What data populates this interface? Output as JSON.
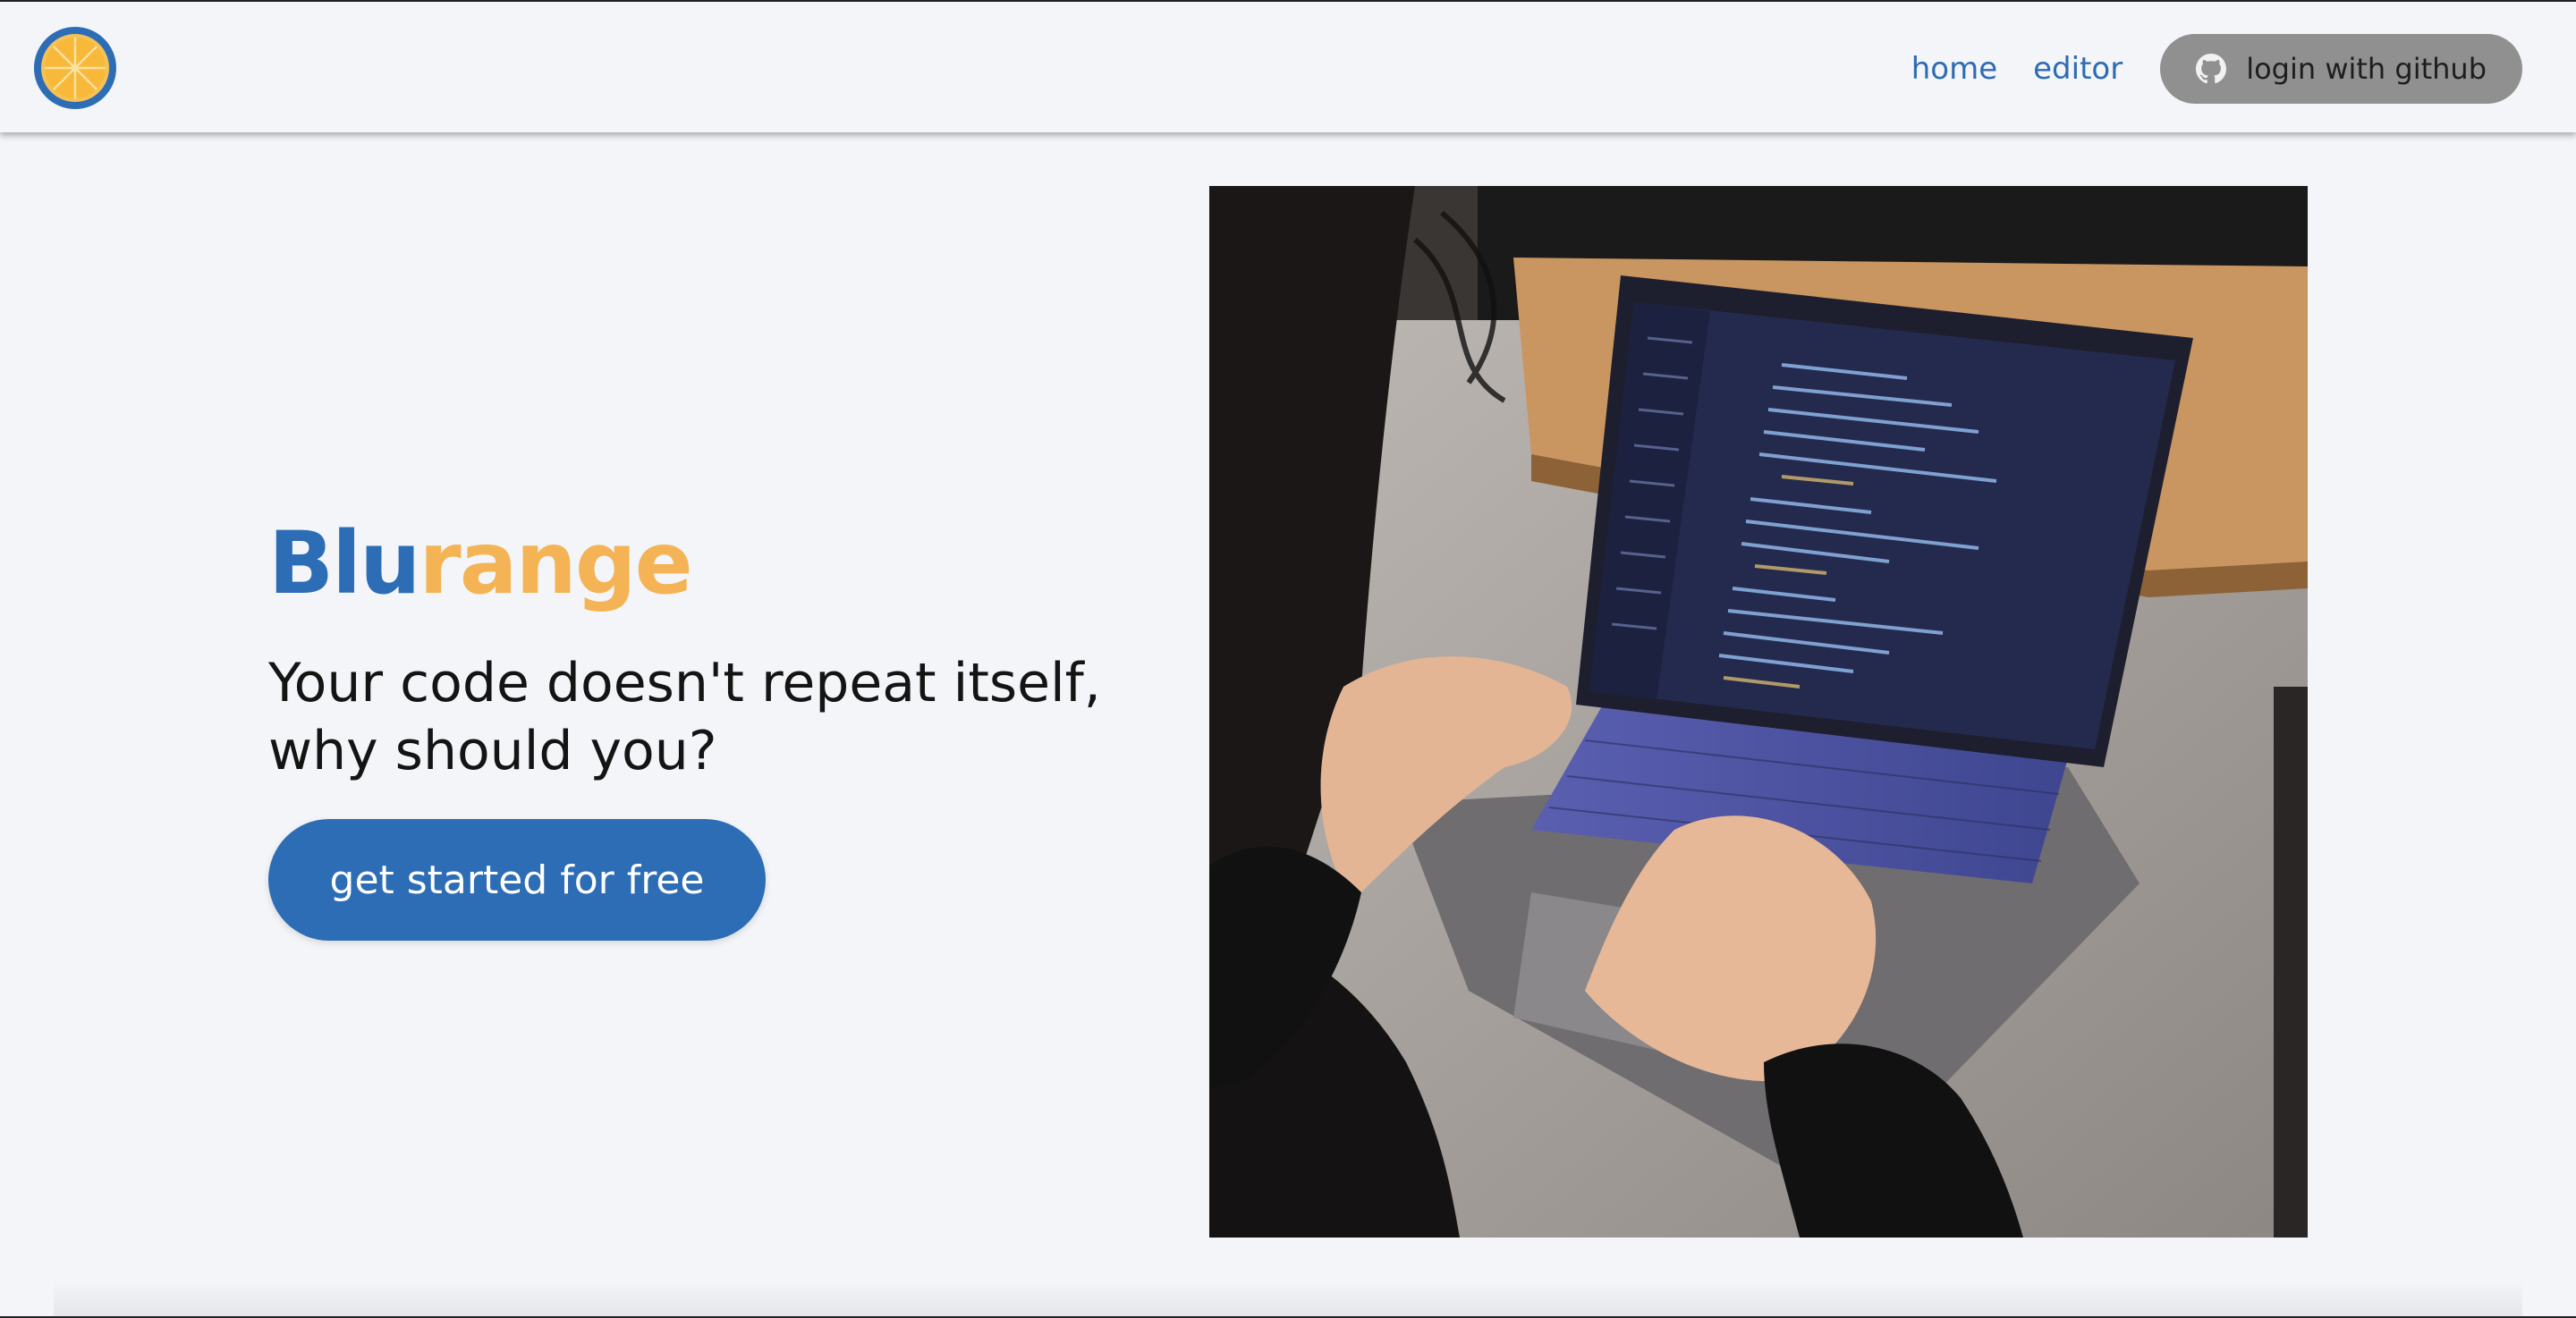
{
  "header": {
    "logo_icon": "orange-slice-logo-icon",
    "nav": {
      "home_label": "home",
      "editor_label": "editor"
    },
    "login": {
      "icon": "github-icon",
      "label": "login with github"
    }
  },
  "hero": {
    "brand_part1": "Blu",
    "brand_part2": "range",
    "tagline_line1": "Your code doesn't repeat itself,",
    "tagline_line2": "why should you?",
    "cta_label": "get started for free"
  },
  "colors": {
    "brand_blue": "#2c6db5",
    "brand_orange": "#f4b455",
    "background": "#f3f5f9",
    "login_button": "#909090"
  }
}
